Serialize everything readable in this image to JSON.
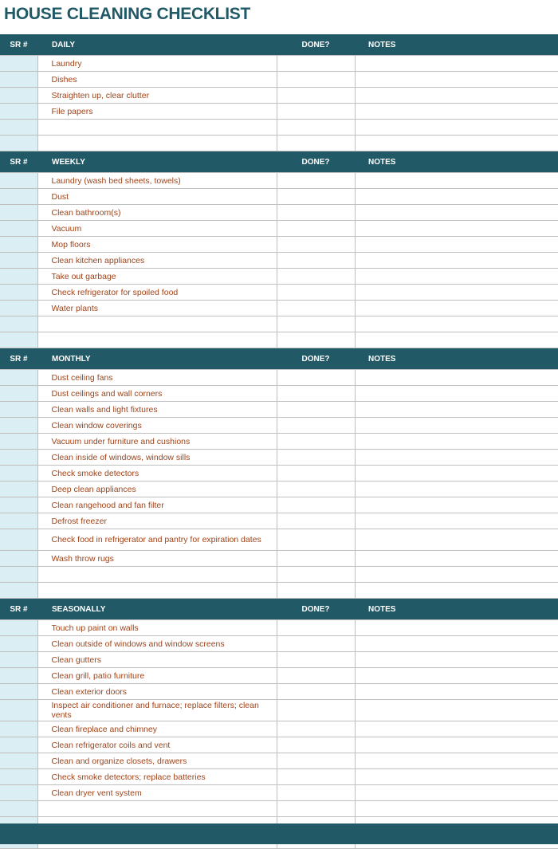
{
  "title": "HOUSE CLEANING CHECKLIST",
  "columns": {
    "sr": "SR #",
    "done": "DONE?",
    "notes": "NOTES"
  },
  "sections": [
    {
      "name": "DAILY",
      "tasks": [
        "Laundry",
        "Dishes",
        "Straighten up, clear clutter",
        "File papers",
        "",
        ""
      ]
    },
    {
      "name": "WEEKLY",
      "tasks": [
        "Laundry (wash bed sheets, towels)",
        "Dust",
        "Clean bathroom(s)",
        "Vacuum",
        "Mop floors",
        "Clean kitchen appliances",
        "Take out garbage",
        "Check refrigerator for spoiled food",
        "Water plants",
        "",
        ""
      ]
    },
    {
      "name": "MONTHLY",
      "tasks": [
        "Dust ceiling fans",
        "Dust ceilings and wall corners",
        "Clean walls and light fixtures",
        "Clean window coverings",
        "Vacuum under furniture and cushions",
        "Clean inside of windows, window sills",
        "Check smoke detectors",
        "Deep clean appliances",
        "Clean rangehood and fan filter",
        "Defrost freezer",
        "Check food in refrigerator and pantry for expiration dates",
        "Wash throw rugs",
        "",
        ""
      ]
    },
    {
      "name": "SEASONALLY",
      "tasks": [
        "Touch up paint on walls",
        "Clean outside of windows and window screens",
        "Clean gutters",
        "Clean grill, patio furniture",
        "Clean exterior doors",
        "Inspect air conditioner and furnace; replace filters; clean vents",
        "Clean fireplace and chimney",
        "Clean refrigerator coils and vent",
        "Clean and organize closets, drawers",
        "Check smoke detectors; replace batteries",
        "Clean dryer vent system",
        "",
        "",
        ""
      ]
    }
  ]
}
